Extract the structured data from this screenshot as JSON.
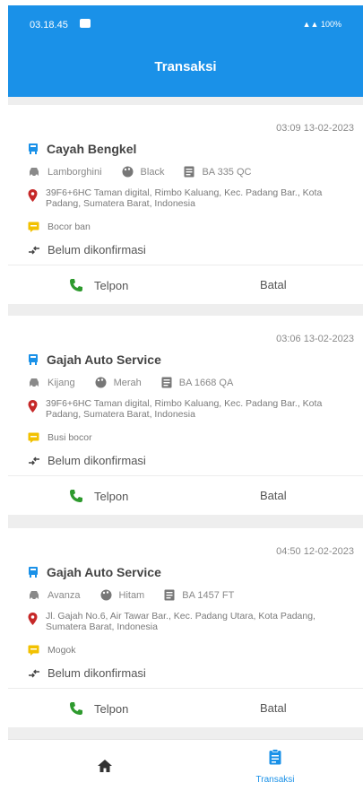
{
  "status_bar": {
    "time": "03.18.45",
    "system": "100%"
  },
  "app_bar": {
    "title": "Transaksi"
  },
  "transactions": [
    {
      "datetime": "03:09 13-02-2023",
      "shop": "Cayah Bengkel",
      "car": "Lamborghini",
      "color": "Black",
      "plate": "BA 335 QC",
      "address": "39F6+6HC Taman digital, Rimbo Kaluang, Kec. Padang Bar., Kota Padang, Sumatera Barat, Indonesia",
      "issue": "Bocor ban",
      "status": "Belum dikonfirmasi",
      "call_label": "Telpon",
      "cancel_label": "Batal"
    },
    {
      "datetime": "03:06 13-02-2023",
      "shop": "Gajah Auto Service",
      "car": "Kijang",
      "color": "Merah",
      "plate": "BA 1668 QA",
      "address": "39F6+6HC Taman digital, Rimbo Kaluang, Kec. Padang Bar., Kota Padang, Sumatera Barat, Indonesia",
      "issue": "Busi bocor",
      "status": "Belum dikonfirmasi",
      "call_label": "Telpon",
      "cancel_label": "Batal"
    },
    {
      "datetime": "04:50 12-02-2023",
      "shop": "Gajah Auto Service",
      "car": "Avanza",
      "color": "Hitam",
      "plate": "BA 1457 FT",
      "address": "Jl. Gajah No.6, Air Tawar Bar., Kec. Padang Utara, Kota Padang, Sumatera Barat, Indonesia",
      "issue": "Mogok",
      "status": "Belum dikonfirmasi",
      "call_label": "Telpon",
      "cancel_label": "Batal"
    }
  ],
  "bottom_nav": {
    "transaksi_label": "Transaksi"
  },
  "colors": {
    "primary": "#1a91e8",
    "call": "#2e9a2e",
    "location": "#c62828",
    "issue": "#f2c100"
  },
  "icons": [
    "store-icon",
    "car-icon",
    "palette-icon",
    "plate-icon",
    "location-icon",
    "issue-icon",
    "status-arrows-icon",
    "phone-icon",
    "home-icon",
    "clipboard-icon"
  ]
}
